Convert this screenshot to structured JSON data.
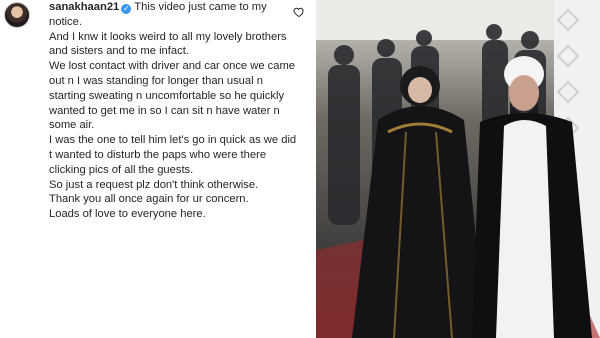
{
  "comment": {
    "username": "sanakhaan21",
    "first_line": "This video just came to my notice.",
    "lines": [
      "And I knw it looks weird to all my lovely brothers and sisters and to me infact.",
      "We lost contact with driver and car once we came out n I was standing for longer than usual n starting sweating n uncomfortable so he quickly wanted to get me in so I can sit n have water n some air.",
      "I was the one to tell him let's go in quick as we did t wanted to disturb the paps who were there clicking pics of all the guests.",
      "So just a request plz don't think otherwise.",
      "Thank you all once again for ur concern.",
      "Loads of love to everyone here."
    ]
  },
  "icons": {
    "verified": "verified-badge-icon",
    "like": "heart-icon"
  },
  "colors": {
    "text": "#262626",
    "verified": "#3897f0",
    "photo_bg": "#2b2b2c"
  }
}
